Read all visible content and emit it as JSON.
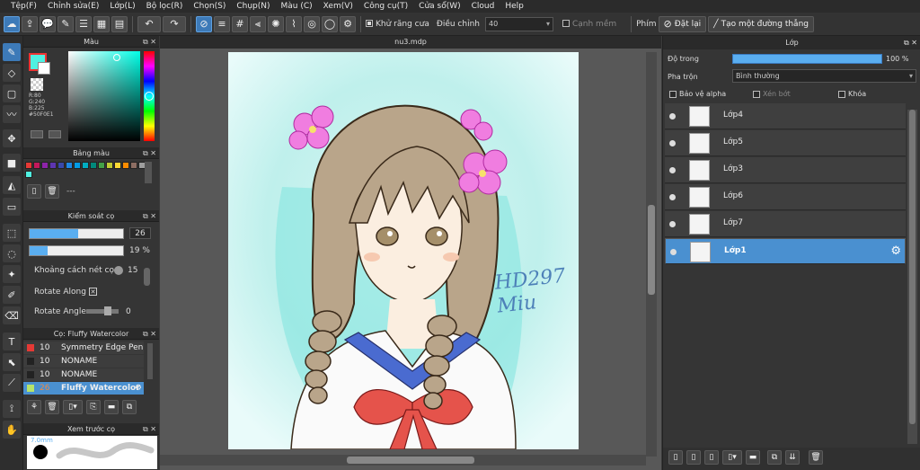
{
  "menu": [
    "Tệp(F)",
    "Chỉnh sửa(E)",
    "Lớp(L)",
    "Bộ lọc(R)",
    "Chọn(S)",
    "Chụp(N)",
    "Màu (C)",
    "Xem(V)",
    "Công cụ(T)",
    "Cửa sổ(W)",
    "Cloud",
    "Help"
  ],
  "toolbar": {
    "antialias_label": "Khử răng cưa",
    "adjust_label": "Điều chỉnh",
    "adjust_value": "40",
    "soft_edge_label": "Cạnh mềm",
    "key_label": "Phím",
    "reset_label": "Đặt lại",
    "straight_line_label": "Tạo một đường thẳng"
  },
  "color_panel": {
    "title": "Màu",
    "r": "R:80",
    "g": "G:240",
    "b": "B:225",
    "hex": "#50F0E1",
    "fg_color": "#50F0E1"
  },
  "palette_panel": {
    "title": "Bảng màu",
    "swatches": [
      "#e53935",
      "#c2185b",
      "#8e24aa",
      "#5e35b1",
      "#3949ab",
      "#1e88e5",
      "#039be5",
      "#00acc1",
      "#00897b",
      "#43a047",
      "#c0ca33",
      "#fdd835",
      "#fb8c00",
      "#8d6e63",
      "#9e9e9e"
    ],
    "name_placeholder": "---"
  },
  "brush_control": {
    "title": "Kiểm soát cọ",
    "size_value": "26",
    "size_fill": 0.52,
    "opacity_value": "19 %",
    "opacity_fill": 0.19,
    "spacing_label": "Khoảng cách nét cọ",
    "spacing_value": "15",
    "rotate_along_label": "Rotate Along",
    "rotate_angle_label": "Rotate Angle",
    "rotate_angle_value": "0"
  },
  "brush_list": {
    "title": "Cọ: Fluffy Watercolor",
    "items": [
      {
        "size": "10",
        "name": "Symmetry Edge Pen",
        "color": "#e53935"
      },
      {
        "size": "10",
        "name": "NONAME",
        "color": "#222222"
      },
      {
        "size": "10",
        "name": "NONAME",
        "color": "#222222"
      },
      {
        "size": "26",
        "name": "Fluffy Watercolor",
        "color": "#b6e36a"
      }
    ]
  },
  "preview_panel": {
    "title": "Xem trước cọ",
    "size_text": "7.0mm"
  },
  "document": {
    "tab": "nu3.mdp",
    "signature": "HD297 Miu"
  },
  "layers_panel": {
    "title": "Lớp",
    "opacity_label": "Độ trong",
    "opacity_value": "100 %",
    "blend_label": "Pha trộn",
    "blend_value": "Bình thường",
    "protect_alpha": "Bảo vệ alpha",
    "clipping": "Xén bớt",
    "lock": "Khóa",
    "layers": [
      {
        "name": "Lớp4",
        "selected": false
      },
      {
        "name": "Lớp5",
        "selected": false
      },
      {
        "name": "Lớp3",
        "selected": false
      },
      {
        "name": "Lớp6",
        "selected": false
      },
      {
        "name": "Lớp7",
        "selected": false
      },
      {
        "name": "Lớp1",
        "selected": true
      }
    ]
  }
}
